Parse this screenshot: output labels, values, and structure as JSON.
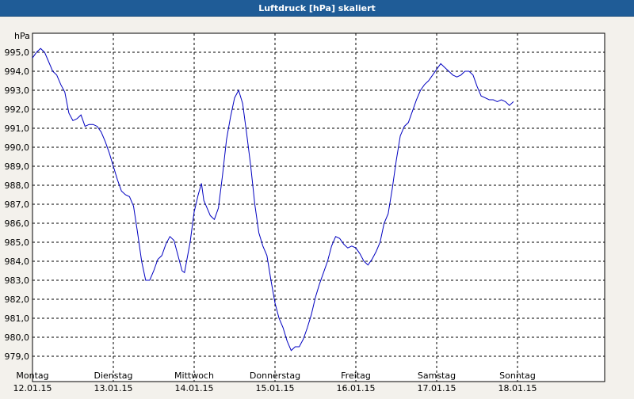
{
  "window": {
    "title": "Luftdruck [hPa] skaliert"
  },
  "colors": {
    "titlebar_bg": "#1f5c97",
    "line": "#0000c0",
    "plot_bg": "#ffffff",
    "page_bg": "#f3f1ec",
    "grid": "#000000"
  },
  "chart_data": {
    "type": "line",
    "title": "Luftdruck [hPa] skaliert",
    "ylabel": "hPa",
    "xlabel": "",
    "ylim": [
      978.5,
      996.0
    ],
    "yticks": [
      979.0,
      980.0,
      981.0,
      982.0,
      983.0,
      984.0,
      985.0,
      986.0,
      987.0,
      988.0,
      989.0,
      990.0,
      991.0,
      992.0,
      993.0,
      994.0,
      995.0
    ],
    "ytick_labels": [
      "979,0",
      "980,0",
      "981,0",
      "982,0",
      "983,0",
      "984,0",
      "985,0",
      "986,0",
      "987,0",
      "988,0",
      "989,0",
      "990,0",
      "991,0",
      "992,0",
      "993,0",
      "994,0",
      "995,0"
    ],
    "xlim": [
      0,
      7
    ],
    "xticks": [
      {
        "x": 0,
        "day": "Montag",
        "date": "12.01.15"
      },
      {
        "x": 1,
        "day": "Dienstag",
        "date": "13.01.15"
      },
      {
        "x": 2,
        "day": "Mittwoch",
        "date": "14.01.15"
      },
      {
        "x": 3,
        "day": "Donnerstag",
        "date": "15.01.15"
      },
      {
        "x": 4,
        "day": "Freitag",
        "date": "16.01.15"
      },
      {
        "x": 5,
        "day": "Samstag",
        "date": "17.01.15"
      },
      {
        "x": 6,
        "day": "Sonntag",
        "date": "18.01.15"
      }
    ],
    "grid": true,
    "series": [
      {
        "points": [
          [
            0.0,
            994.7
          ],
          [
            0.05,
            995.0
          ],
          [
            0.1,
            995.2
          ],
          [
            0.15,
            995.0
          ],
          [
            0.2,
            994.5
          ],
          [
            0.25,
            994.0
          ],
          [
            0.3,
            993.8
          ],
          [
            0.35,
            993.3
          ],
          [
            0.4,
            992.9
          ],
          [
            0.45,
            991.8
          ],
          [
            0.5,
            991.4
          ],
          [
            0.55,
            991.5
          ],
          [
            0.6,
            991.7
          ],
          [
            0.65,
            991.1
          ],
          [
            0.7,
            991.2
          ],
          [
            0.75,
            991.2
          ],
          [
            0.8,
            991.1
          ],
          [
            0.85,
            990.8
          ],
          [
            0.9,
            990.3
          ],
          [
            0.95,
            989.7
          ],
          [
            1.0,
            989.0
          ],
          [
            1.05,
            988.3
          ],
          [
            1.1,
            987.7
          ],
          [
            1.15,
            987.5
          ],
          [
            1.2,
            987.4
          ],
          [
            1.25,
            986.9
          ],
          [
            1.3,
            985.5
          ],
          [
            1.35,
            984.0
          ],
          [
            1.4,
            983.0
          ],
          [
            1.45,
            983.0
          ],
          [
            1.5,
            983.5
          ],
          [
            1.55,
            984.1
          ],
          [
            1.6,
            984.3
          ],
          [
            1.65,
            984.9
          ],
          [
            1.7,
            985.3
          ],
          [
            1.75,
            985.1
          ],
          [
            1.8,
            984.3
          ],
          [
            1.85,
            983.5
          ],
          [
            1.88,
            983.4
          ],
          [
            1.95,
            985.0
          ],
          [
            2.0,
            986.6
          ],
          [
            2.05,
            987.5
          ],
          [
            2.09,
            988.1
          ],
          [
            2.12,
            987.2
          ],
          [
            2.2,
            986.4
          ],
          [
            2.25,
            986.2
          ],
          [
            2.3,
            986.8
          ],
          [
            2.35,
            988.5
          ],
          [
            2.4,
            990.4
          ],
          [
            2.45,
            991.6
          ],
          [
            2.5,
            992.6
          ],
          [
            2.55,
            993.0
          ],
          [
            2.6,
            992.3
          ],
          [
            2.65,
            990.7
          ],
          [
            2.7,
            989.0
          ],
          [
            2.75,
            987.0
          ],
          [
            2.8,
            985.5
          ],
          [
            2.85,
            984.8
          ],
          [
            2.9,
            984.3
          ],
          [
            2.95,
            983.0
          ],
          [
            3.0,
            981.8
          ],
          [
            3.05,
            981.0
          ],
          [
            3.1,
            980.5
          ],
          [
            3.15,
            979.8
          ],
          [
            3.2,
            979.3
          ],
          [
            3.25,
            979.5
          ],
          [
            3.3,
            979.5
          ],
          [
            3.35,
            979.9
          ],
          [
            3.4,
            980.5
          ],
          [
            3.45,
            981.2
          ],
          [
            3.5,
            982.1
          ],
          [
            3.55,
            982.8
          ],
          [
            3.6,
            983.4
          ],
          [
            3.65,
            984.0
          ],
          [
            3.7,
            984.8
          ],
          [
            3.75,
            985.3
          ],
          [
            3.8,
            985.2
          ],
          [
            3.85,
            984.9
          ],
          [
            3.9,
            984.7
          ],
          [
            3.95,
            984.8
          ],
          [
            4.0,
            984.7
          ],
          [
            4.05,
            984.4
          ],
          [
            4.1,
            984.0
          ],
          [
            4.15,
            983.8
          ],
          [
            4.2,
            984.1
          ],
          [
            4.25,
            984.5
          ],
          [
            4.3,
            985.0
          ],
          [
            4.35,
            986.0
          ],
          [
            4.4,
            986.5
          ],
          [
            4.45,
            987.8
          ],
          [
            4.5,
            989.3
          ],
          [
            4.55,
            990.6
          ],
          [
            4.6,
            991.1
          ],
          [
            4.65,
            991.3
          ],
          [
            4.7,
            991.9
          ],
          [
            4.75,
            992.5
          ],
          [
            4.8,
            993.0
          ],
          [
            4.85,
            993.3
          ],
          [
            4.9,
            993.5
          ],
          [
            4.95,
            993.8
          ],
          [
            5.0,
            994.1
          ],
          [
            5.05,
            994.4
          ],
          [
            5.1,
            994.2
          ],
          [
            5.15,
            994.0
          ],
          [
            5.2,
            993.8
          ],
          [
            5.25,
            993.7
          ],
          [
            5.3,
            993.8
          ],
          [
            5.35,
            994.0
          ],
          [
            5.4,
            994.0
          ],
          [
            5.45,
            993.8
          ],
          [
            5.5,
            993.2
          ],
          [
            5.55,
            992.7
          ],
          [
            5.6,
            992.6
          ],
          [
            5.65,
            992.5
          ],
          [
            5.7,
            992.5
          ],
          [
            5.75,
            992.4
          ],
          [
            5.8,
            992.5
          ],
          [
            5.85,
            992.4
          ],
          [
            5.9,
            992.2
          ],
          [
            5.95,
            992.4
          ]
        ]
      }
    ]
  }
}
